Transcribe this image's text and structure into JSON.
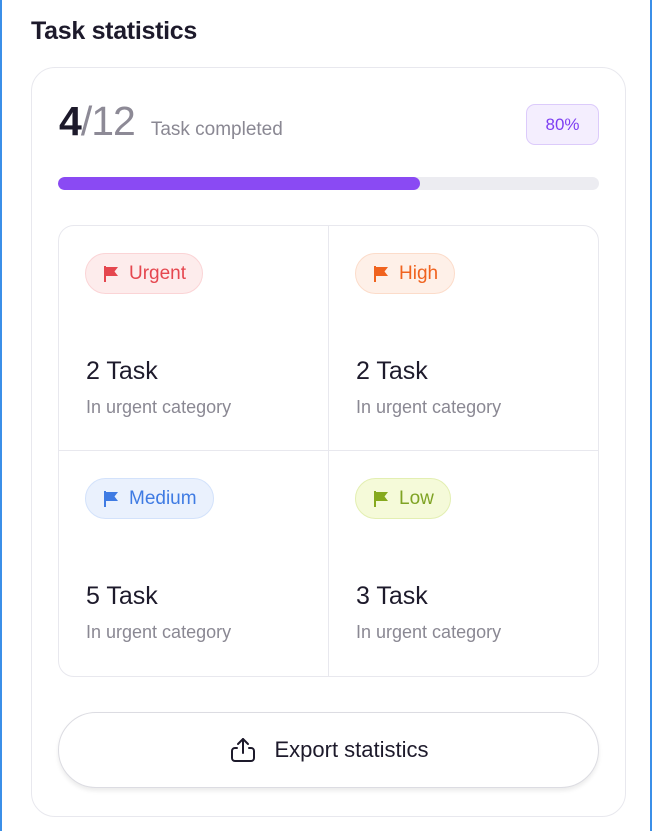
{
  "header": {
    "title": "Task statistics"
  },
  "summary": {
    "completed": "4",
    "total": "/12",
    "label": "Task completed",
    "badge": "80%",
    "progress_fraction": 0.67
  },
  "categories": [
    {
      "priority": "Urgent",
      "count": "2 Task",
      "subtitle": "In urgent category",
      "text_color": "#e5474f",
      "bg": "#fdecec",
      "border": "#fbd4d6",
      "flag_color": "#e5474f",
      "flag_icon": "flag-icon"
    },
    {
      "priority": "High",
      "count": "2 Task",
      "subtitle": "In urgent category",
      "text_color": "#f0631f",
      "bg": "#fef0e8",
      "border": "#fcdcca",
      "flag_color": "#f0631f",
      "flag_icon": "flag-icon"
    },
    {
      "priority": "Medium",
      "count": "5 Task",
      "subtitle": "In urgent category",
      "text_color": "#3f7be3",
      "bg": "#eaf1fd",
      "border": "#d3e2fb",
      "flag_color": "#3f7be3",
      "flag_icon": "flag-icon"
    },
    {
      "priority": "Low",
      "count": "3 Task",
      "subtitle": "In urgent category",
      "text_color": "#7fa324",
      "bg": "#f5fad9",
      "border": "#e3efb2",
      "flag_color": "#85a91e",
      "flag_icon": "flag-icon"
    }
  ],
  "export": {
    "label": "Export statistics",
    "icon": "upload-icon"
  }
}
